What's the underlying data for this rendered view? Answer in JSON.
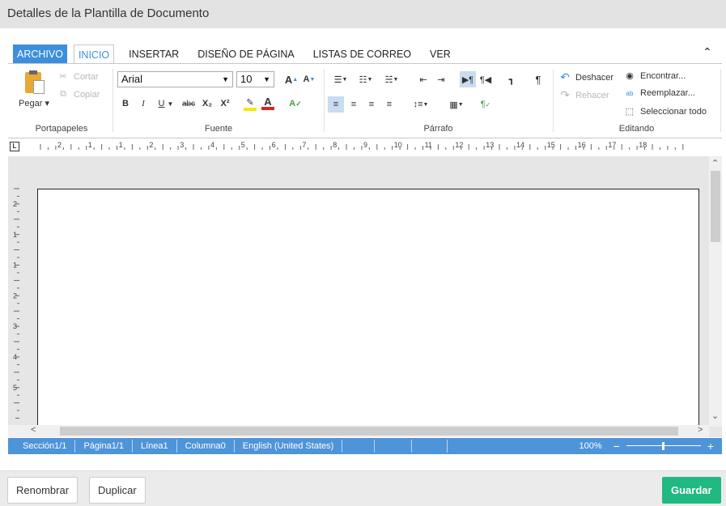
{
  "window": {
    "title": "Detalles de la Plantilla de Documento"
  },
  "tabs": [
    "ARCHIVO",
    "INICIO",
    "INSERTAR",
    "DISEÑO DE PÁGINA",
    "LISTAS DE CORREO",
    "VER"
  ],
  "clipboard": {
    "paste": "Pegar",
    "cut": "Cortar",
    "copy": "Copiar",
    "label": "Portapapeles"
  },
  "font": {
    "family": "Arial",
    "size": "10",
    "label": "Fuente",
    "bold": "B",
    "italic": "I",
    "underline": "U",
    "strike": "abc",
    "sub": "X₂",
    "sup": "X²"
  },
  "paragraph": {
    "label": "Párrafo"
  },
  "editing": {
    "undo": "Deshacer",
    "redo": "Rehacer",
    "find": "Encontrar...",
    "replace": "Reemplazar...",
    "select_all": "Seleccionar todo",
    "label": "Editando"
  },
  "ruler": {
    "h_ticks": [
      "2",
      "1",
      "1",
      "2",
      "3",
      "4",
      "5",
      "6",
      "7",
      "8",
      "9",
      "10",
      "11",
      "12",
      "13",
      "14",
      "15",
      "16",
      "17",
      "18"
    ],
    "v_ticks": [
      "2",
      "1",
      "1",
      "2",
      "3",
      "4",
      "5"
    ]
  },
  "status": {
    "section": "Sección1/1",
    "page": "Página1/1",
    "line": "Línea1",
    "column": "Columna0",
    "language": "English (United States)",
    "zoom": "100%"
  },
  "footer": {
    "rename": "Renombrar",
    "duplicate": "Duplicar",
    "save": "Guardar"
  },
  "colors": {
    "accent": "#3b8fdc",
    "status_bar": "#4e94d8",
    "save": "#1fb981"
  }
}
